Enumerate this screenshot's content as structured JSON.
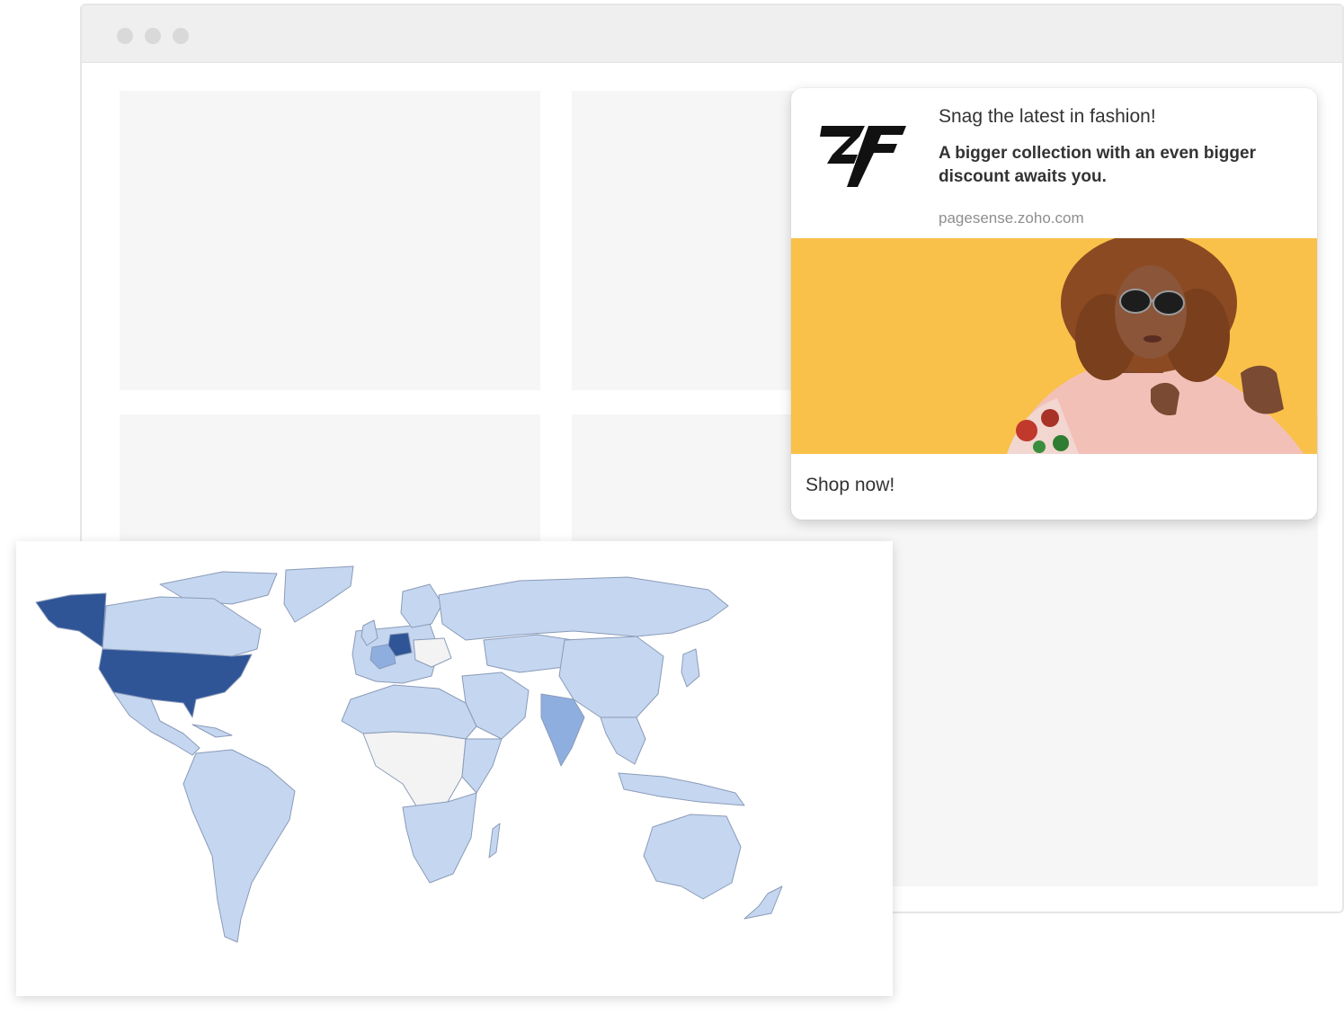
{
  "notification": {
    "title": "Snag the latest in fashion!",
    "body": "A bigger collection with an even bigger discount awaits you.",
    "url": "pagesense.zoho.com",
    "action_label": "Shop now!",
    "image_background": "#f9c14a"
  },
  "map": {
    "colors": {
      "high": "#2f5597",
      "medium": "#8faee0",
      "low": "#c5d6f0",
      "none": "#f3f3f3"
    }
  }
}
